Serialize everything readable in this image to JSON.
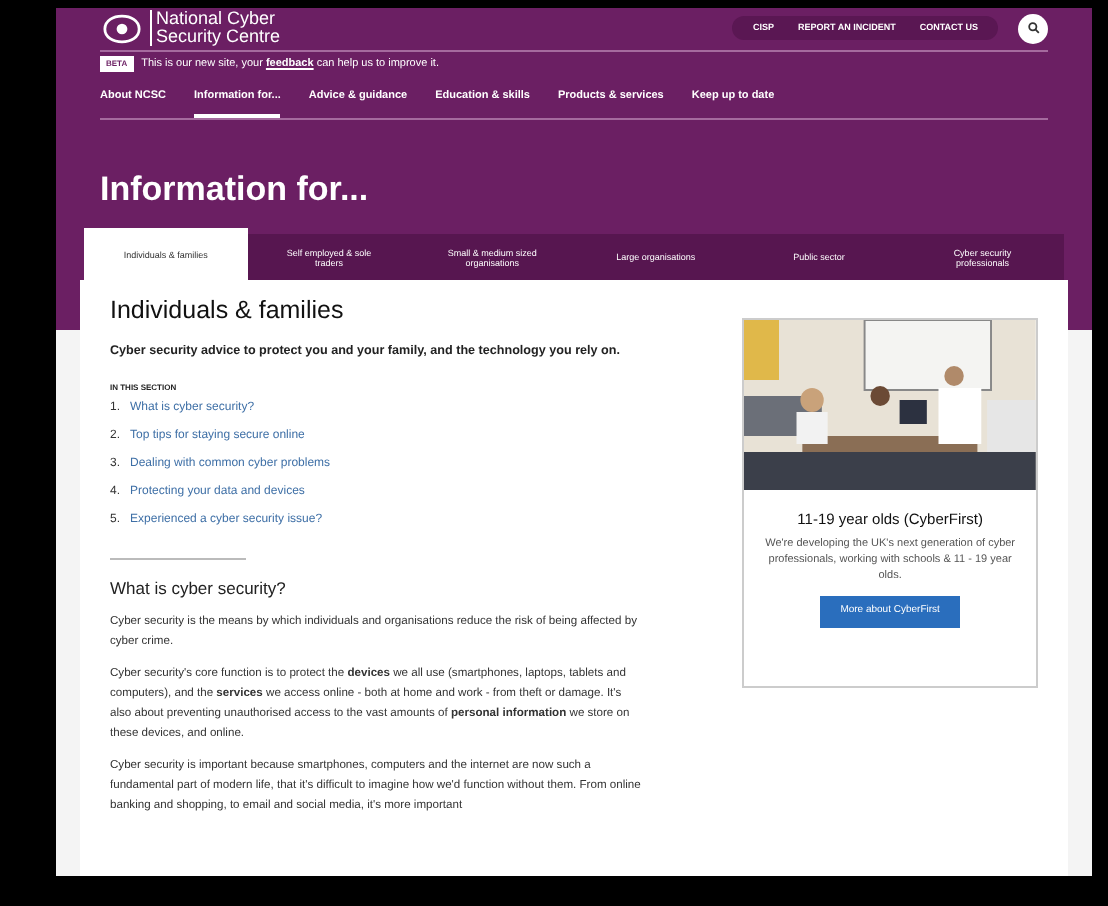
{
  "header": {
    "logo_lines": [
      "National Cyber",
      "Security Centre"
    ],
    "utility_links": [
      "CISP",
      "REPORT AN INCIDENT",
      "CONTACT US"
    ]
  },
  "beta": {
    "badge": "BETA",
    "message": "This is our new site, your **feedback** can help us to improve it."
  },
  "nav": [
    {
      "label": "About NCSC",
      "selected": false
    },
    {
      "label": "Information for...",
      "selected": true
    },
    {
      "label": "Advice & guidance",
      "selected": false
    },
    {
      "label": "Education & skills",
      "selected": false
    },
    {
      "label": "Products & services",
      "selected": false
    },
    {
      "label": "Keep up to date",
      "selected": false
    }
  ],
  "page_title": "Information for...",
  "tabs": [
    {
      "label": "Individuals & families",
      "selected": true
    },
    {
      "label": "Self employed & sole traders",
      "selected": false
    },
    {
      "label": "Small & medium sized organisations",
      "selected": false
    },
    {
      "label": "Large organisations",
      "selected": false
    },
    {
      "label": "Public sector",
      "selected": false
    },
    {
      "label": "Cyber security professionals",
      "selected": false
    }
  ],
  "section": {
    "title": "Individuals & families",
    "intro": "Cyber security advice to protect you and your family, and the technology you rely on."
  },
  "in_this_section": {
    "heading": "IN THIS SECTION",
    "items": [
      {
        "number": "1.",
        "label": "What is cyber security?"
      },
      {
        "number": "2.",
        "label": "Top tips for staying secure online"
      },
      {
        "number": "3.",
        "label": "Dealing with common cyber problems"
      },
      {
        "number": "4.",
        "label": "Protecting your data and devices"
      },
      {
        "number": "5.",
        "label": "Experienced a cyber security issue?"
      }
    ]
  },
  "article": {
    "heading": "What is cyber security?",
    "paragraphs": [
      "Cyber security is the means by which individuals and organisations reduce the risk of being affected by cyber crime.",
      "Cyber security's core function is to protect the **devices** we all use (smartphones, laptops, tablets and computers), and the **services** we access online - both at home and work - from theft or damage. It's also about preventing unauthorised access to the vast amounts of **personal information** we store on these devices, and online.",
      "Cyber security is important because smartphones, computers and the internet are now such a fundamental part of modern life, that it's difficult to imagine how we'd function without them. From online banking and shopping, to email and social media, it's more important"
    ]
  },
  "promo": {
    "title": "11-19 year olds (CyberFirst)",
    "text": "We're developing the UK's next generation of cyber professionals, working with schools & 11 - 19 year olds.",
    "button": "More about CyberFirst"
  }
}
